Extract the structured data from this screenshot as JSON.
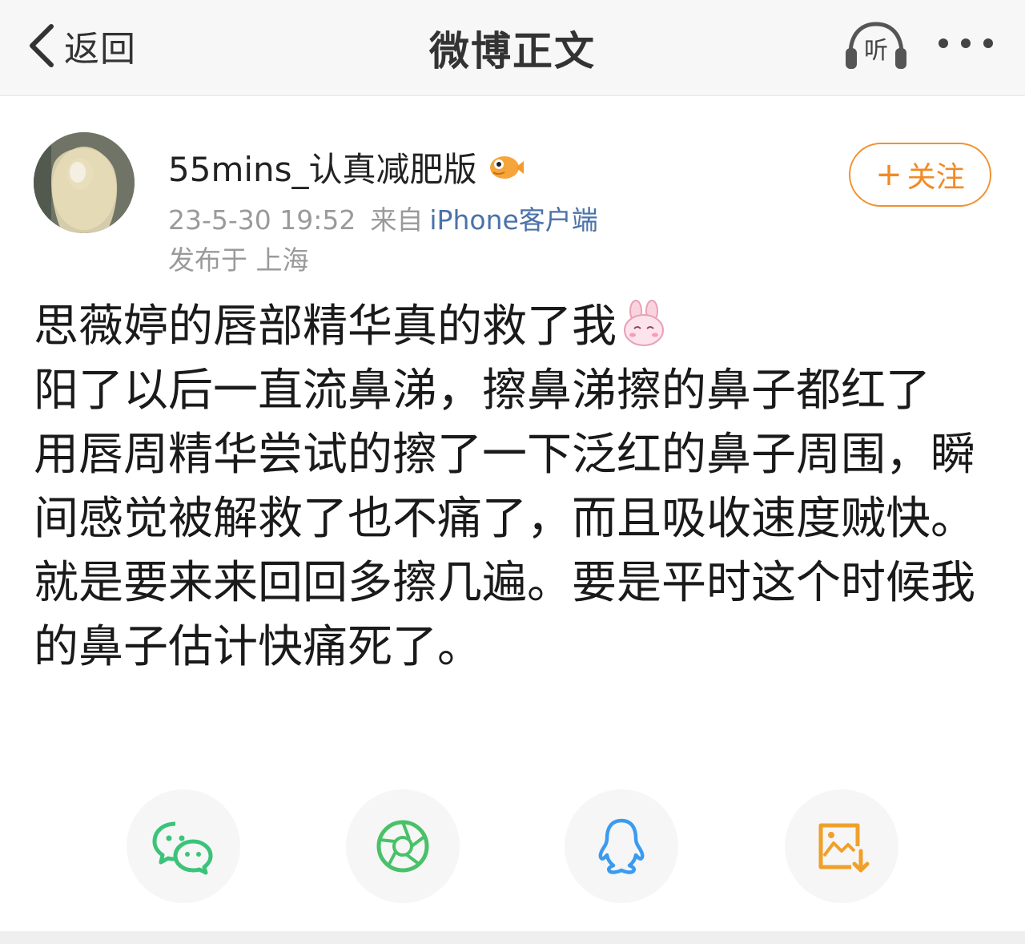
{
  "nav": {
    "back_label": "返回",
    "title": "微博正文",
    "listen_label": "听"
  },
  "post": {
    "username": "55mins_认真减肥版",
    "date": "23-5-30 19:52",
    "from_prefix": "来自",
    "client": "iPhone客户端",
    "location": "发布于 上海",
    "follow_label": "关注",
    "follow_plus": "+",
    "body_lines": [
      "思薇婷的唇部精华真的救了我",
      "阳了以后一直流鼻涕，擦鼻涕擦的鼻子都红了",
      "用唇周精华尝试的擦了一下泛红的鼻子周围，瞬间感觉被解救了也不痛了，而且吸收速度贼快。就是要来来回回多擦几遍。要是平时这个时候我的鼻子估计快痛死了。"
    ]
  },
  "share": {
    "items": [
      {
        "icon": "wechat-icon",
        "color": "#3cc37a"
      },
      {
        "icon": "wechat-moments-icon",
        "color": "#49c168"
      },
      {
        "icon": "qq-icon",
        "color": "#3a9bf0"
      },
      {
        "icon": "save-image-icon",
        "color": "#f0a02a"
      }
    ]
  },
  "colors": {
    "accent_orange": "#f08a24",
    "link_blue": "#4b72a8",
    "meta_gray": "#9a9a9a"
  }
}
